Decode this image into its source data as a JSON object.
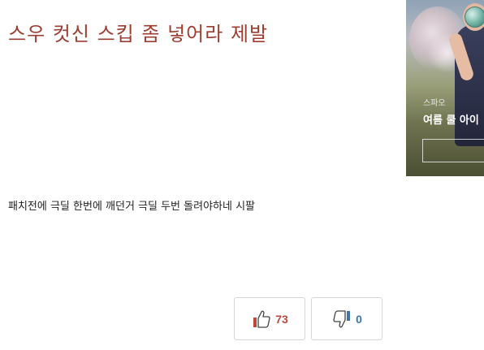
{
  "post": {
    "title": "스우 컷신 스킵 좀 넣어라 제발",
    "body": "패치전에 극딜 한번에 깨던거 극딜 두번 돌려야하네 시팔"
  },
  "ad": {
    "brand": "스파오",
    "tagline": "여름 쿨 아이"
  },
  "votes": {
    "up_count": "73",
    "down_count": "0",
    "up_icon": "thumbs-up-icon",
    "down_icon": "thumbs-down-icon"
  },
  "colors": {
    "title": "#9c3d30",
    "up": "#b84a3e",
    "down": "#3f74a8"
  }
}
